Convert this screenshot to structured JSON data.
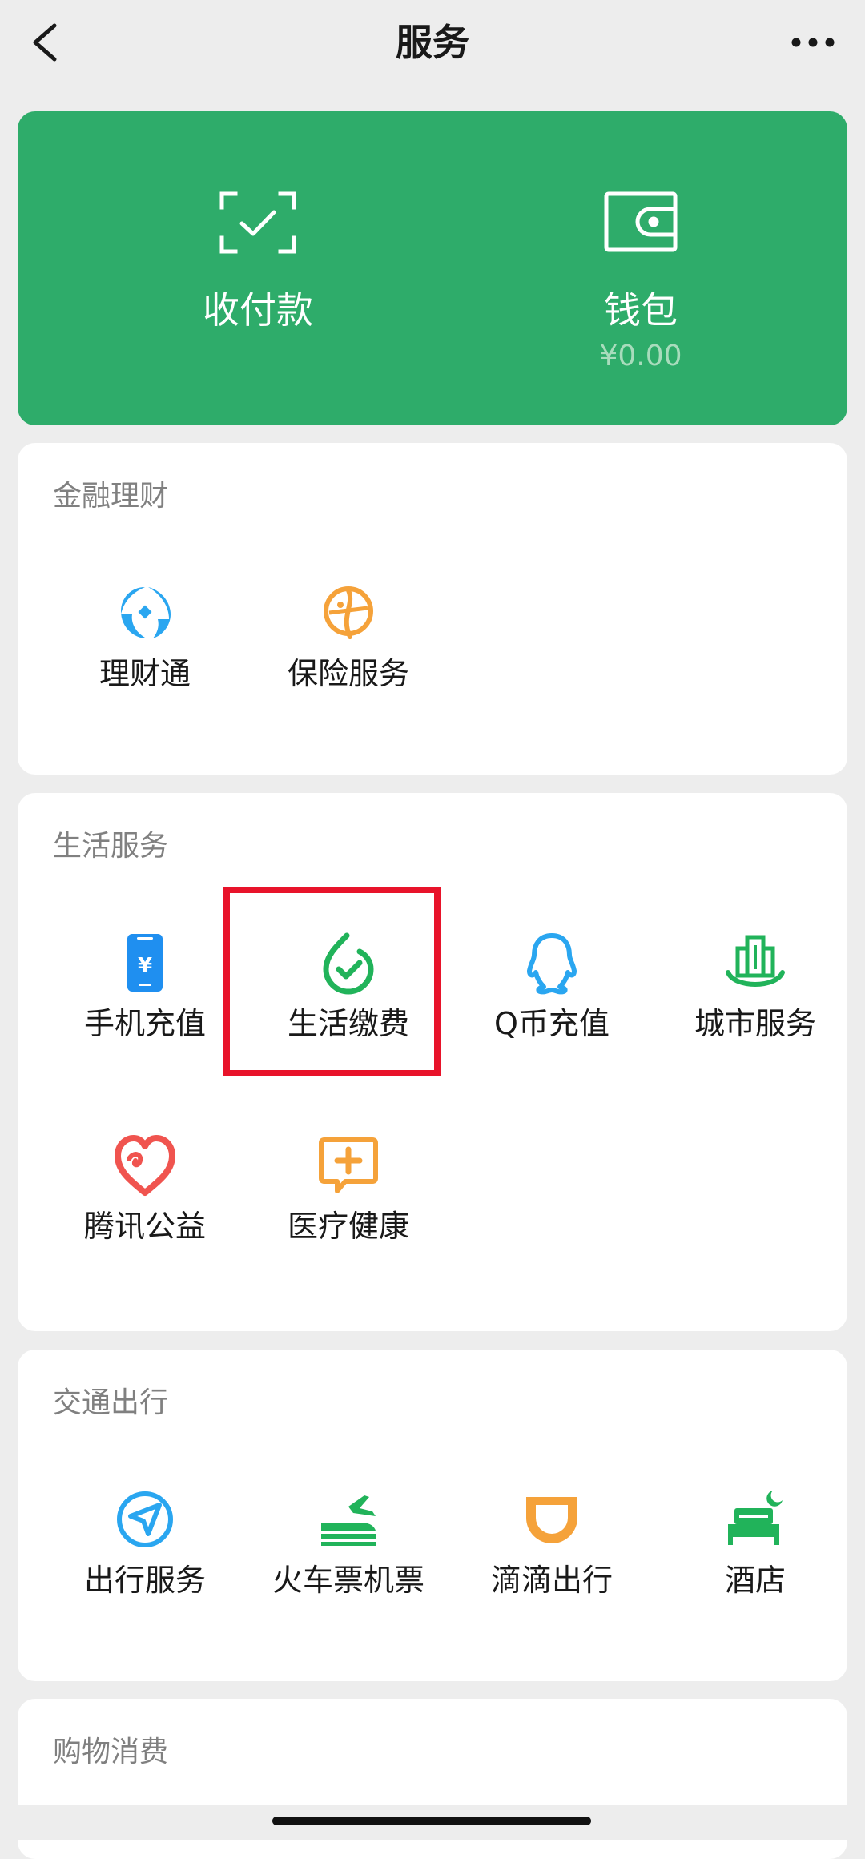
{
  "header": {
    "title": "服务",
    "back_icon": "chevron-left-icon",
    "more_icon": "more-dots-icon"
  },
  "wallet_card": {
    "background": "#2eac6a",
    "pay": {
      "label": "收付款",
      "icon": "scan-check-icon"
    },
    "wallet": {
      "label": "钱包",
      "balance": "¥0.00",
      "icon": "wallet-icon"
    }
  },
  "sections": {
    "finance": {
      "title": "金融理财",
      "items": [
        {
          "label": "理财通",
          "icon": "licaitong-icon",
          "color": "#2aa6f0"
        },
        {
          "label": "保险服务",
          "icon": "insurance-icon",
          "color": "#f5a23a"
        }
      ]
    },
    "life": {
      "title": "生活服务",
      "items": [
        {
          "label": "手机充值",
          "icon": "phone-topup-icon",
          "color": "#1f8ff0"
        },
        {
          "label": "生活缴费",
          "icon": "utility-payment-icon",
          "color": "#21b35a"
        },
        {
          "label": "Q币充值",
          "icon": "qq-coin-icon",
          "color": "#2aa6f0"
        },
        {
          "label": "城市服务",
          "icon": "city-service-icon",
          "color": "#21b35a"
        },
        {
          "label": "腾讯公益",
          "icon": "charity-heart-icon",
          "color": "#f0544f"
        },
        {
          "label": "医疗健康",
          "icon": "medical-icon",
          "color": "#f5a23a"
        }
      ]
    },
    "transport": {
      "title": "交通出行",
      "items": [
        {
          "label": "出行服务",
          "icon": "navigation-icon",
          "color": "#2aa6f0"
        },
        {
          "label": "火车票机票",
          "icon": "train-plane-icon",
          "color": "#21b35a"
        },
        {
          "label": "滴滴出行",
          "icon": "didi-icon",
          "color": "#f5a23a"
        },
        {
          "label": "酒店",
          "icon": "hotel-bed-icon",
          "color": "#21b35a"
        }
      ]
    },
    "shopping": {
      "title": "购物消费"
    }
  },
  "highlight_color": "#e8132a"
}
